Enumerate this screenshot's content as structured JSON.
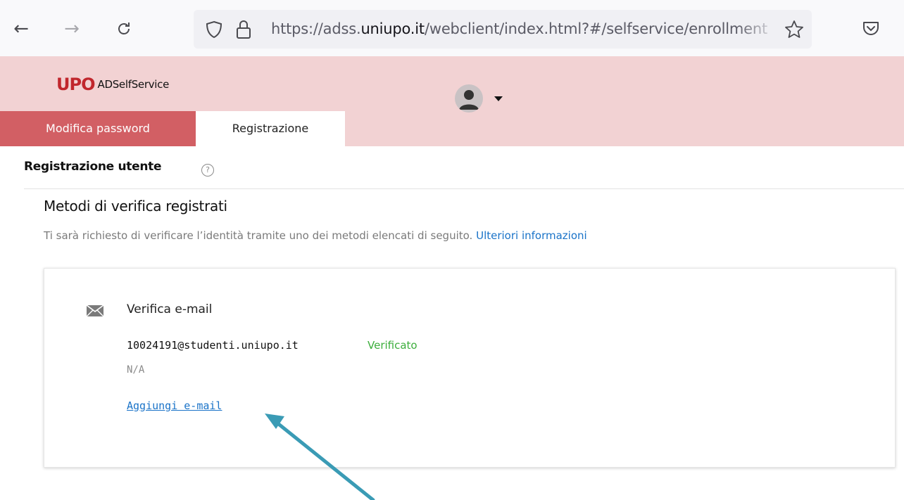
{
  "browser": {
    "url_prefix": "https://adss.",
    "url_domain": "uniupo.it",
    "url_path": "/webclient/index.html?#/selfservice/enrollment",
    "icons": [
      "back-icon",
      "forward-icon",
      "reload-icon",
      "shield-icon",
      "lock-icon",
      "star-icon",
      "pocket-icon"
    ]
  },
  "header": {
    "logo_mark": "UPO",
    "logo_text": "ADSelfService",
    "tabs": [
      {
        "label": "Modifica password",
        "active": false
      },
      {
        "label": "Registrazione",
        "active": true
      }
    ]
  },
  "main": {
    "page_title": "Registrazione utente",
    "help_glyph": "?",
    "section_title": "Metodi di verifica registrati",
    "section_description": "Ti sarà richiesto di verificare l’identità tramite uno dei metodi elencati di seguito.",
    "more_info_link": "Ulteriori informazioni",
    "method": {
      "title": "Verifica e-mail",
      "email": "10024191@studenti.uniupo.it",
      "status": "Verificato",
      "secondary": "N/A",
      "add_link": "Aggiungi e-mail"
    }
  },
  "colors": {
    "header_bg": "#f2d2d3",
    "tab_inactive_bg": "#d25f64",
    "brand_red": "#c1272d",
    "link": "#1a73c8",
    "status_ok": "#3cae3c",
    "annotation_arrow": "#3a9bb5"
  }
}
